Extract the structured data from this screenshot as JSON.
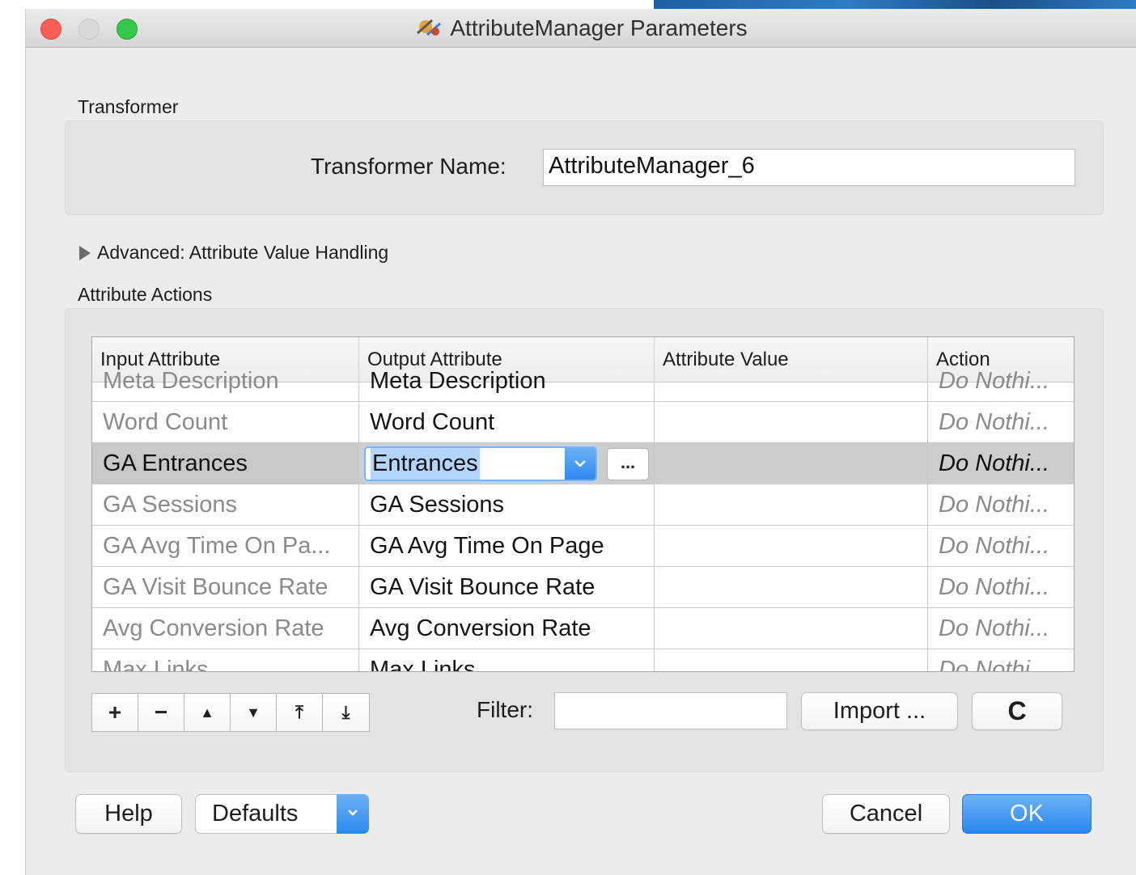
{
  "window": {
    "title": "AttributeManager Parameters"
  },
  "transformer": {
    "section_label": "Transformer",
    "name_label": "Transformer Name:",
    "name_value": "AttributeManager_6"
  },
  "advanced": {
    "label": "Advanced: Attribute Value Handling"
  },
  "attribute_actions": {
    "section_label": "Attribute Actions",
    "columns": [
      "Input Attribute",
      "Output Attribute",
      "Attribute Value",
      "Action"
    ],
    "rows": [
      {
        "input": "Meta Description",
        "output": "Meta Description",
        "value": "",
        "action": "Do Nothi..."
      },
      {
        "input": "Word Count",
        "output": "Word Count",
        "value": "",
        "action": "Do Nothi..."
      },
      {
        "input": "GA Entrances",
        "output": "Entrances",
        "value": "",
        "action": "Do Nothi..."
      },
      {
        "input": "GA Sessions",
        "output": "GA Sessions",
        "value": "",
        "action": "Do Nothi..."
      },
      {
        "input": "GA Avg Time On Pa...",
        "output": "GA Avg Time On Page",
        "value": "",
        "action": "Do Nothi..."
      },
      {
        "input": "GA Visit Bounce Rate",
        "output": "GA Visit Bounce Rate",
        "value": "",
        "action": "Do Nothi..."
      },
      {
        "input": "Avg Conversion Rate",
        "output": "Avg Conversion Rate",
        "value": "",
        "action": "Do Nothi..."
      },
      {
        "input": "Max Links",
        "output": "Max Links",
        "value": "",
        "action": "Do Nothi..."
      }
    ],
    "selected_row": 2,
    "ellipsis_label": "..."
  },
  "toolbar": {
    "buttons": [
      "+",
      "−",
      "▲",
      "▼",
      "⤒",
      "⤓"
    ],
    "icons": [
      "plus-icon",
      "minus-icon",
      "move-up-icon",
      "move-down-icon",
      "move-top-icon",
      "move-bottom-icon"
    ]
  },
  "filter": {
    "label": "Filter:",
    "value": ""
  },
  "buttons": {
    "import": "Import ...",
    "refresh": "C",
    "help": "Help",
    "defaults": "Defaults",
    "cancel": "Cancel",
    "ok": "OK"
  },
  "colors": {
    "accent": "#2d8af0",
    "selected_row": "#cdcdcd",
    "close": "#fc5f57",
    "maximize": "#35c84a"
  }
}
